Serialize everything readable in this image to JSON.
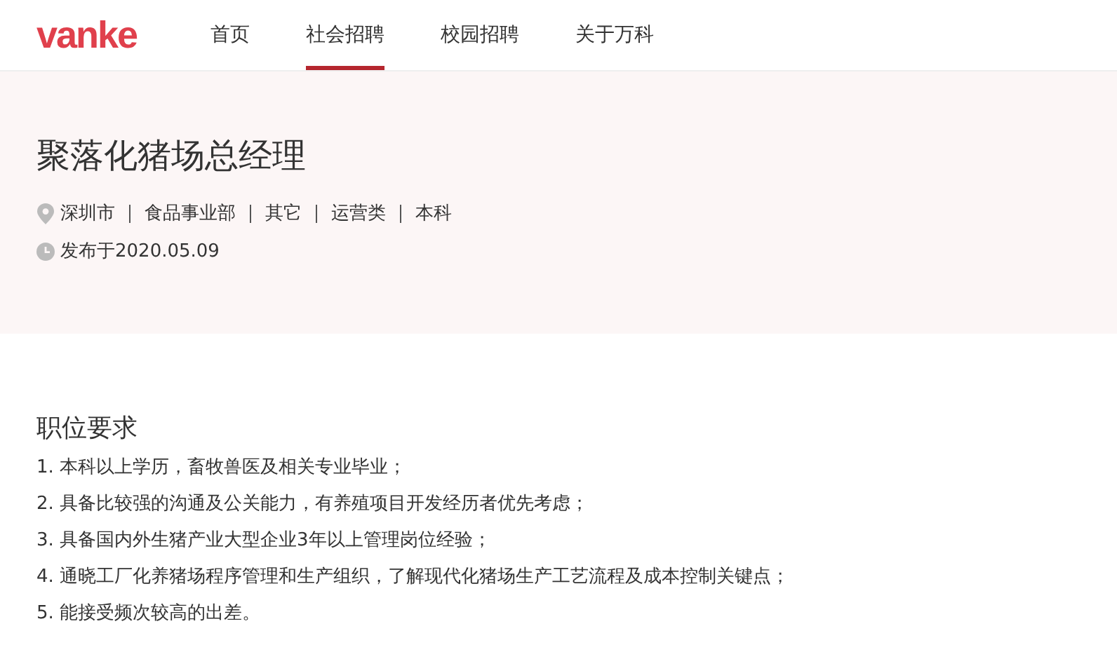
{
  "logo": "vanke",
  "nav": [
    {
      "label": "首页",
      "selected": false
    },
    {
      "label": "社会招聘",
      "selected": true
    },
    {
      "label": "校园招聘",
      "selected": false
    },
    {
      "label": "关于万科",
      "selected": false
    }
  ],
  "job": {
    "title": "聚落化猪场总经理",
    "tags": [
      "深圳市",
      "食品事业部",
      "其它",
      "运营类",
      "本科"
    ],
    "published": "发布于2020.05.09"
  },
  "requirements": {
    "heading": "职位要求",
    "items": [
      "1. 本科以上学历，畜牧兽医及相关专业毕业；",
      "2. 具备比较强的沟通及公关能力，有养殖项目开发经历者优先考虑；",
      "3. 具备国内外生猪产业大型企业3年以上管理岗位经验；",
      "4. 通晓工厂化养猪场程序管理和生产组织，了解现代化猪场生产工艺流程及成本控制关键点；",
      "5. 能接受频次较高的出差。"
    ]
  }
}
